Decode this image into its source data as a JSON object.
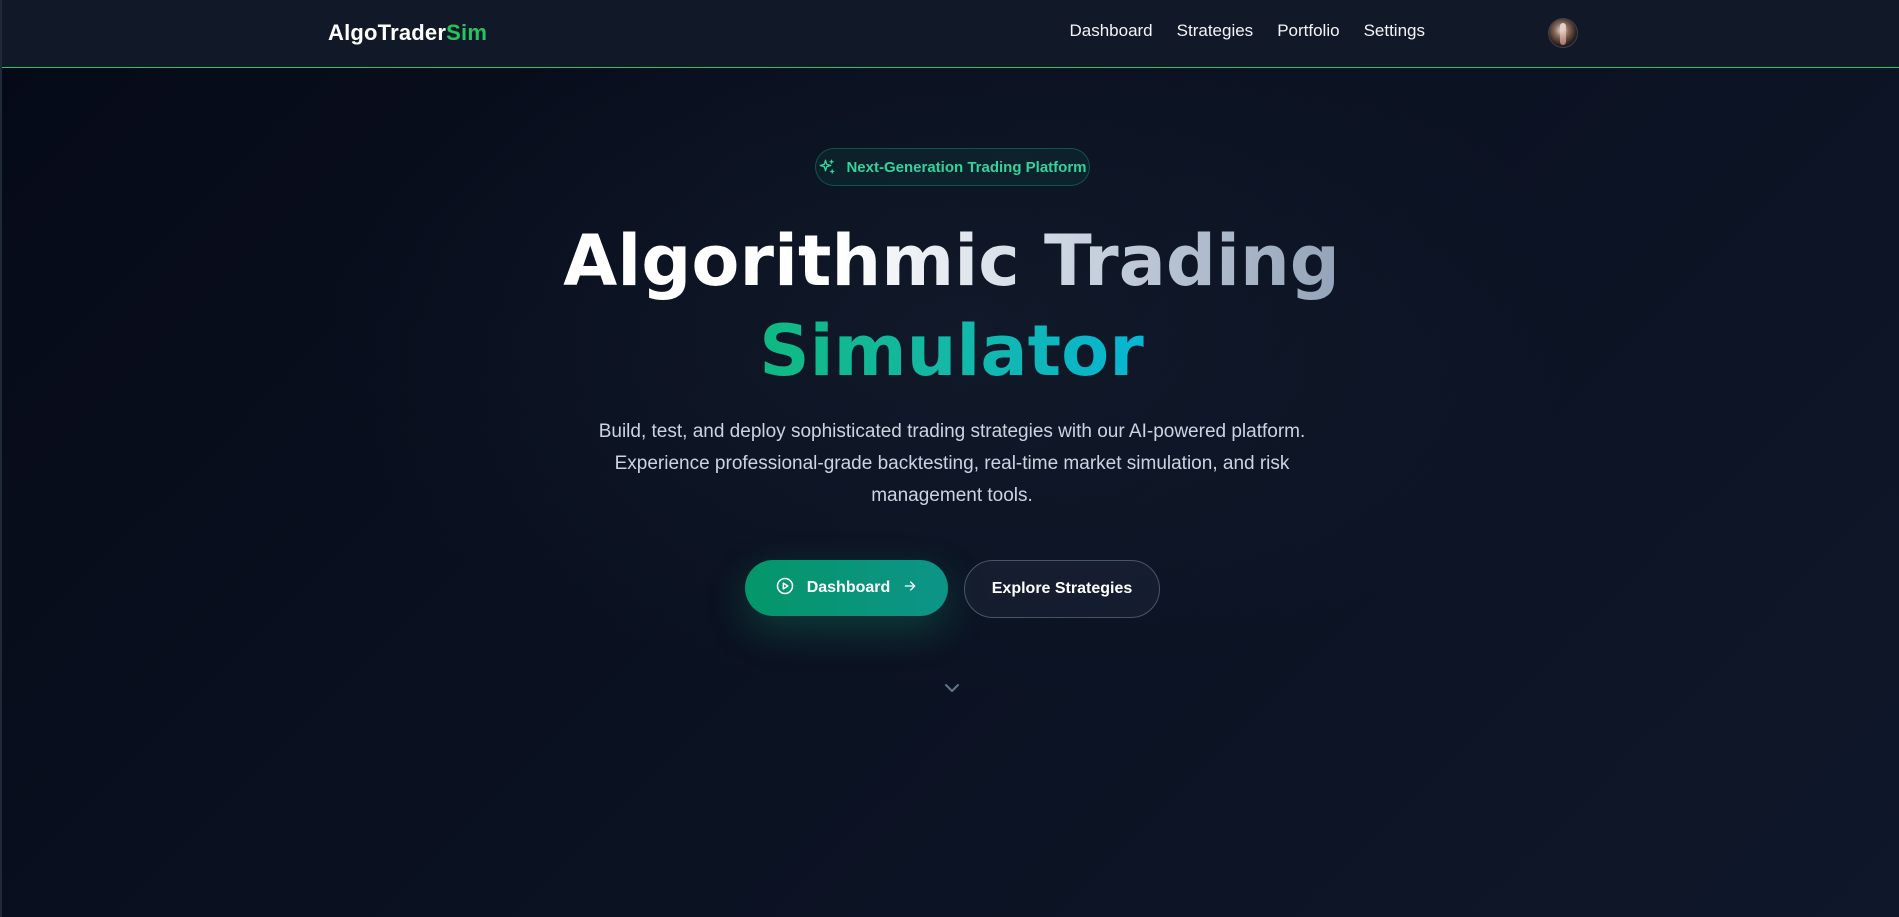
{
  "brand": {
    "name": "AlgoTrader",
    "accent": "Sim"
  },
  "nav": {
    "items": [
      {
        "label": "Dashboard"
      },
      {
        "label": "Strategies"
      },
      {
        "label": "Portfolio"
      },
      {
        "label": "Settings"
      }
    ]
  },
  "hero": {
    "badge": "Next-Generation Trading Platform",
    "headline_line1": "Algorithmic Trading",
    "headline_line2": "Simulator",
    "subtitle": "Build, test, and deploy sophisticated trading strategies with our AI-powered platform. Experience professional-grade backtesting, real-time market simulation, and risk management tools.",
    "primary_cta": "Dashboard",
    "secondary_cta": "Explore Strategies"
  },
  "icons": {
    "badge": "sparkles-icon",
    "primary_left": "play-circle-icon",
    "primary_right": "arrow-right-icon",
    "scroll": "chevron-down-icon"
  },
  "colors": {
    "accent_green": "#22c55e",
    "button_gradient_start": "#059669",
    "button_gradient_end": "#0d9488",
    "headline_gradient_start": "#10b981",
    "headline_gradient_end": "#06b6d4",
    "background": "#0a0f1c"
  }
}
